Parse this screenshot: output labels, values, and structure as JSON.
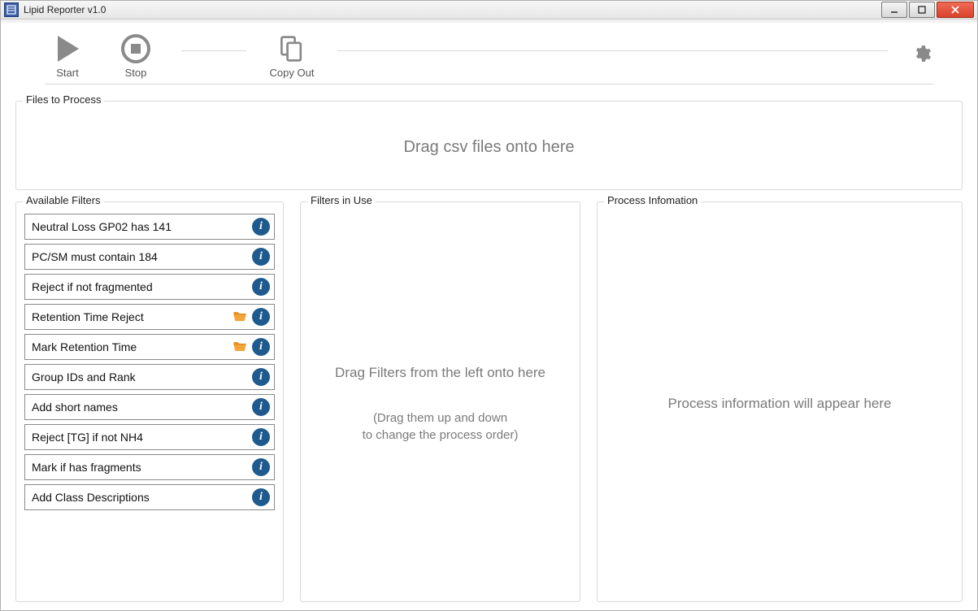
{
  "window": {
    "title": "Lipid Reporter v1.0"
  },
  "toolbar": {
    "start_label": "Start",
    "stop_label": "Stop",
    "copy_out_label": "Copy Out"
  },
  "groups": {
    "files_legend": "Files to Process",
    "files_hint": "Drag csv files onto here",
    "available_legend": "Available Filters",
    "in_use_legend": "Filters in Use",
    "in_use_hint": "Drag Filters from the left onto here",
    "in_use_sub1": "(Drag them up and down",
    "in_use_sub2": "to change the process order)",
    "info_legend": "Process Infomation",
    "info_hint": "Process information will appear here"
  },
  "filters": [
    {
      "label": "Neutral Loss GP02 has 141",
      "has_folder": false
    },
    {
      "label": "PC/SM must contain 184",
      "has_folder": false
    },
    {
      "label": "Reject if not fragmented",
      "has_folder": false
    },
    {
      "label": "Retention Time Reject",
      "has_folder": true
    },
    {
      "label": "Mark Retention Time",
      "has_folder": true
    },
    {
      "label": "Group IDs and Rank",
      "has_folder": false
    },
    {
      "label": "Add short names",
      "has_folder": false
    },
    {
      "label": "Reject [TG] if not NH4",
      "has_folder": false
    },
    {
      "label": "Mark if has fragments",
      "has_folder": false
    },
    {
      "label": "Add Class Descriptions",
      "has_folder": false
    }
  ],
  "colors": {
    "accent_info": "#1e5a8e",
    "folder": "#e58a1f",
    "toolbar_icon": "#888888",
    "close_btn": "#d9422a"
  }
}
